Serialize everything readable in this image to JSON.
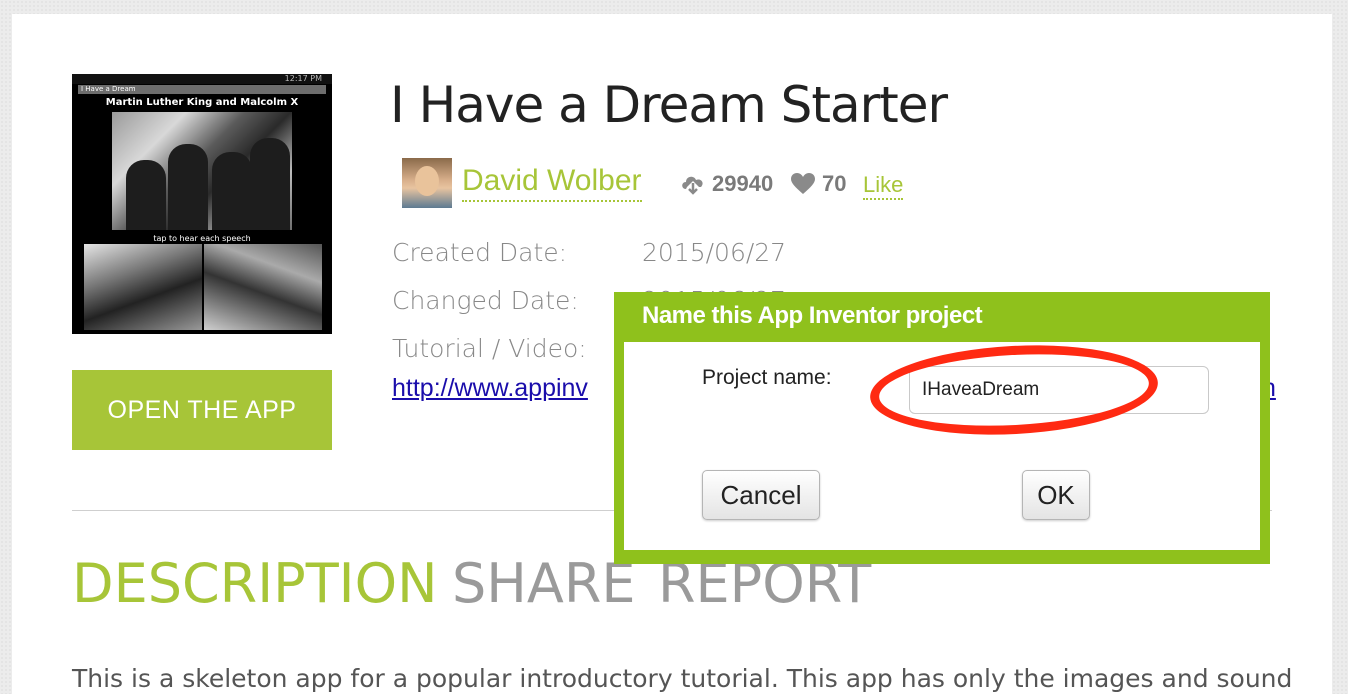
{
  "app": {
    "title": "I Have a Dream Starter",
    "open_button": "OPEN THE APP",
    "thumbnail": {
      "status_time": "12:17 PM",
      "screen_title": "I Have a Dream",
      "heading": "Martin Luther King and Malcolm X",
      "caption": "tap to hear each speech"
    }
  },
  "author": {
    "name": "David Wolber",
    "downloads": "29940",
    "likes": "70",
    "like_label": "Like"
  },
  "meta": {
    "created_label": "Created Date:",
    "created_value": "2015/06/27",
    "changed_label": "Changed Date:",
    "changed_value": "2015/06/27",
    "tutorial_label": "Tutorial / Video:",
    "tutorial_link": "http://www.appinv",
    "tutorial_link_tail": "n"
  },
  "tabs": [
    {
      "label": "DESCRIPTION",
      "active": true
    },
    {
      "label": "SHARE",
      "active": false
    },
    {
      "label": "REPORT",
      "active": false
    }
  ],
  "description": "This is a skeleton app for a popular introductory tutorial. This app has only the images and sound",
  "dialog": {
    "title": "Name this App Inventor project",
    "field_label": "Project name:",
    "field_value": "IHaveaDream",
    "cancel_label": "Cancel",
    "ok_label": "OK"
  },
  "colors": {
    "accent_green": "#a7c538",
    "dialog_green": "#8fc11c",
    "highlight_red": "#ff2a12",
    "link_blue": "#1a0dab"
  },
  "icons": [
    "download-cloud-icon",
    "heart-icon"
  ]
}
